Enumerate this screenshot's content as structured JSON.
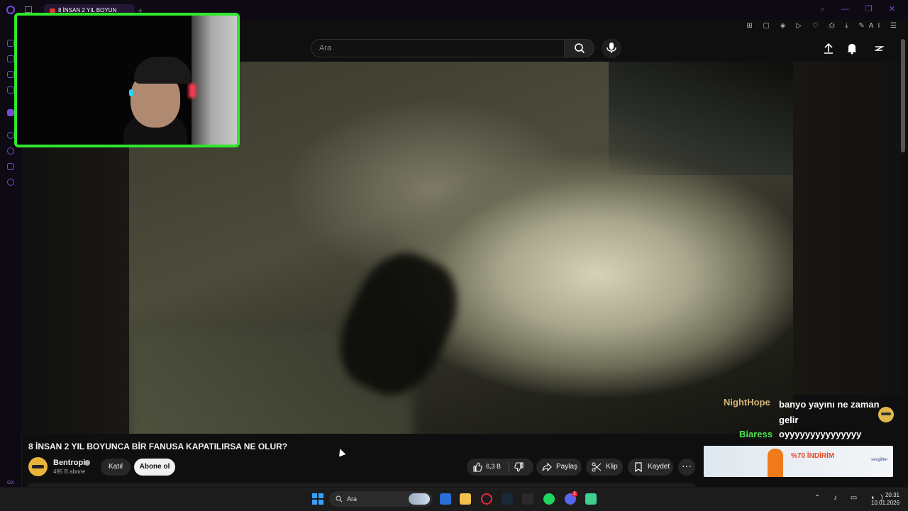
{
  "browser": {
    "tab_title": "8 İNSAN 2 YIL BOYUN",
    "accent": "#7a4bd6",
    "ai_label": "AI"
  },
  "search": {
    "placeholder": "Ara"
  },
  "video": {
    "title": "8 İNSAN 2 YIL BOYUNCA BİR FANUSA KAPATILIRSA NE OLUR?",
    "channel": "Bentropi",
    "subscribers": "495 B abone",
    "join_label": "Katıl",
    "subscribe_label": "Abone ol",
    "like_count": "6,3 B",
    "share_label": "Paylaş",
    "clip_label": "Klip",
    "save_label": "Kaydet"
  },
  "chat": {
    "messages": [
      {
        "user": "NightHope",
        "text": "banyo yayını ne zaman gelir",
        "color": "#d4b57a"
      },
      {
        "user": "Biaress",
        "text": "oyyyyyyyyyyyyyyy",
        "color": "#4fe34f"
      }
    ]
  },
  "ad": {
    "headline": "%70 İNDİRİM",
    "brand": "sevgililer"
  },
  "taskbar": {
    "search_label": "Ara",
    "time": "20:31",
    "date": "10.01.2026",
    "discord_badge": "2"
  },
  "sidebar": {
    "gx_label": "GX"
  },
  "colors": {
    "webcam_border": "#2ee82e",
    "background": "#0f0f0f"
  }
}
